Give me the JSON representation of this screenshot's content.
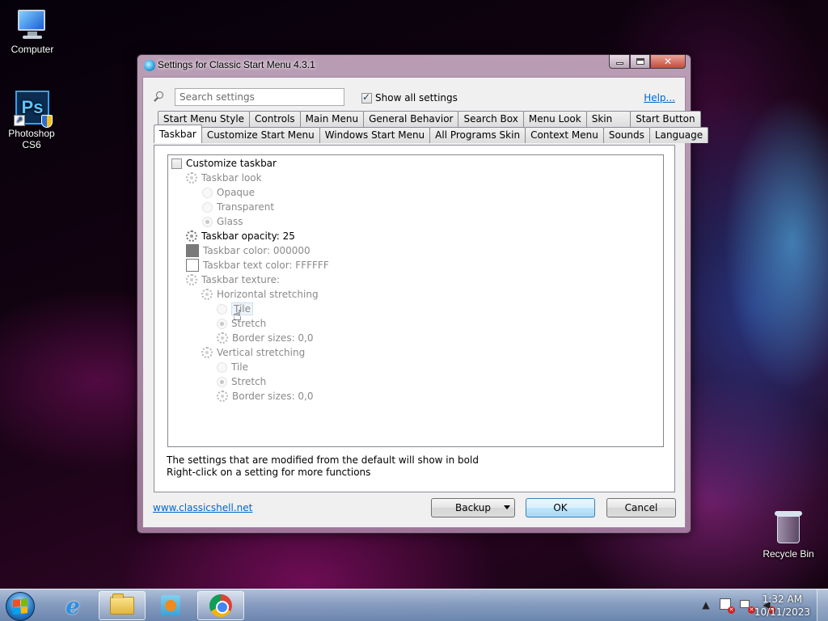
{
  "desktop": {
    "icons": [
      {
        "label": "Computer",
        "icon": "computer-icon"
      },
      {
        "label": "Photoshop CS6",
        "icon": "photoshop-icon"
      },
      {
        "label": "Recycle Bin",
        "icon": "recycle-bin-icon"
      }
    ]
  },
  "dialog": {
    "title": "Settings for Classic Start Menu 4.3.1",
    "search_placeholder": "Search settings",
    "show_all_label": "Show all settings",
    "show_all_checked": true,
    "help_link": "Help...",
    "tabs_row1": [
      "Start Menu Style",
      "Controls",
      "Main Menu",
      "General Behavior",
      "Search Box",
      "Menu Look",
      "Skin",
      "Start Button"
    ],
    "tabs_row2": [
      "Taskbar",
      "Customize Start Menu",
      "Windows Start Menu",
      "All Programs Skin",
      "Context Menu",
      "Sounds",
      "Language"
    ],
    "active_tab": "Taskbar",
    "tree": {
      "customize_taskbar": "Customize taskbar",
      "taskbar_look": "Taskbar look",
      "opaque": "Opaque",
      "transparent": "Transparent",
      "glass": "Glass",
      "taskbar_opacity": "Taskbar opacity: 25",
      "taskbar_color": "Taskbar color: 000000",
      "taskbar_text_color": "Taskbar text color: FFFFFF",
      "taskbar_texture": "Taskbar texture:",
      "horizontal_stretching": "Horizontal stretching",
      "h_tile": "Tile",
      "h_stretch": "Stretch",
      "h_border": "Border sizes: 0,0",
      "vertical_stretching": "Vertical stretching",
      "v_tile": "Tile",
      "v_stretch": "Stretch",
      "v_border": "Border sizes: 0,0"
    },
    "colors": {
      "taskbar_color": "#7a7a7a",
      "taskbar_text_color": "#ffffff"
    },
    "info_line1": "The settings that are modified from the default will show in bold",
    "info_line2": "Right-click on a setting for more functions",
    "website_link": "www.classicshell.net",
    "backup_label": "Backup",
    "ok_label": "OK",
    "cancel_label": "Cancel"
  },
  "taskbar": {
    "pinned": [
      "internet-explorer-icon",
      "file-explorer-icon",
      "media-player-icon",
      "chrome-icon"
    ],
    "time": "1:32 AM",
    "date": "10/11/2023"
  }
}
